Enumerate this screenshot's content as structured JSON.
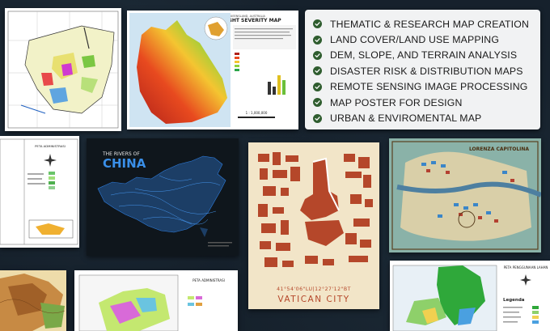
{
  "drought_map": {
    "small_title": "QUEENSLAND, AUSTRALIA",
    "title": "DROUGHT SEVERITY MAP",
    "scale": "1 : 1,000,000"
  },
  "rivers_map": {
    "line1": "THE RIVERS OF",
    "line2": "CHINA"
  },
  "vatican_map": {
    "coords": "41°54'06\"LU|12°27'12\"BT",
    "name": "VATICAN CITY"
  },
  "town_map": {
    "title": "LORENZA CAPITOLINA"
  },
  "admin_map_left": {
    "title": "PETA ADMINISTRASI"
  },
  "admin_map_bottom": {
    "title": "PETA ADMINISTRASI"
  },
  "landuse_map": {
    "title": "PETA PENGGUNAAN LAHAN",
    "legend": "Legenda"
  },
  "colors": {
    "check": "#2f5d2f",
    "background": "#16212c",
    "china_blue": "#2e7ee0",
    "vatican_red": "#b5472a"
  },
  "services": [
    {
      "label": "THEMATIC & RESEARCH MAP CREATION",
      "icon": "check-circle-icon"
    },
    {
      "label": "LAND COVER/LAND USE MAPPING",
      "icon": "check-circle-icon"
    },
    {
      "label": "DEM, SLOPE, AND TERRAIN ANALYSIS",
      "icon": "check-circle-icon"
    },
    {
      "label": "DISASTER RISK & DISTRIBUTION MAPS",
      "icon": "check-circle-icon"
    },
    {
      "label": "REMOTE SENSING IMAGE PROCESSING",
      "icon": "check-circle-icon"
    },
    {
      "label": "MAP POSTER FOR DESIGN",
      "icon": "check-circle-icon"
    },
    {
      "label": "URBAN & ENVIROMENTAL MAP",
      "icon": "check-circle-icon"
    }
  ]
}
